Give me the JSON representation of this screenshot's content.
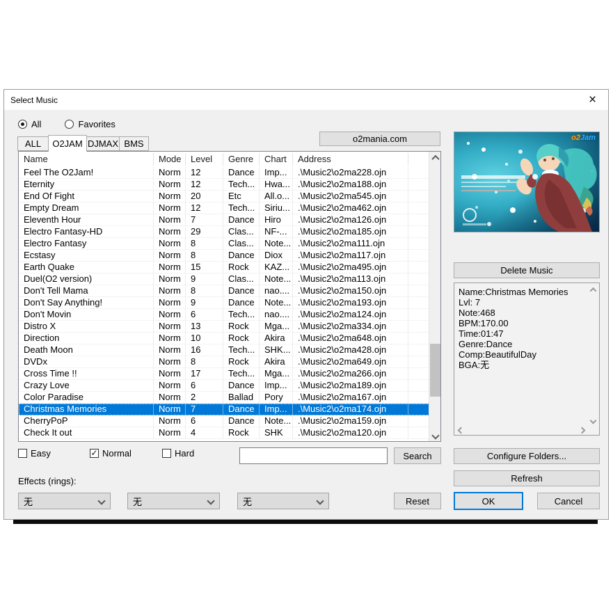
{
  "window": {
    "title": "Select Music",
    "close_icon": "×"
  },
  "filter": {
    "options": [
      {
        "label": "All",
        "selected": true
      },
      {
        "label": "Favorites",
        "selected": false
      }
    ]
  },
  "tabs": [
    {
      "label": "ALL",
      "active": false
    },
    {
      "label": "O2JAM",
      "active": true
    },
    {
      "label": "DJMAX",
      "active": false
    },
    {
      "label": "BMS",
      "active": false
    }
  ],
  "website_button": {
    "label": "o2mania.com"
  },
  "table": {
    "columns": [
      "Name",
      "Mode",
      "Level",
      "Genre",
      "Chart",
      "Address"
    ],
    "selected_index": 20,
    "rows": [
      {
        "name": "Feel The O2Jam!",
        "mode": "Norm",
        "level": "12",
        "genre": "Dance",
        "chart": "Imp...",
        "address": ".\\Music2\\o2ma228.ojn"
      },
      {
        "name": "Eternity",
        "mode": "Norm",
        "level": "12",
        "genre": "Tech...",
        "chart": "Hwa...",
        "address": ".\\Music2\\o2ma188.ojn"
      },
      {
        "name": "End Of Fight",
        "mode": "Norm",
        "level": "20",
        "genre": "Etc",
        "chart": "All.o...",
        "address": ".\\Music2\\o2ma545.ojn"
      },
      {
        "name": "Empty Dream",
        "mode": "Norm",
        "level": "12",
        "genre": "Tech...",
        "chart": "Siriu...",
        "address": ".\\Music2\\o2ma462.ojn"
      },
      {
        "name": "Eleventh Hour",
        "mode": "Norm",
        "level": "7",
        "genre": "Dance",
        "chart": "Hiro",
        "address": ".\\Music2\\o2ma126.ojn"
      },
      {
        "name": "Electro Fantasy-HD",
        "mode": "Norm",
        "level": "29",
        "genre": "Clas...",
        "chart": "NF-...",
        "address": ".\\Music2\\o2ma185.ojn"
      },
      {
        "name": "Electro Fantasy",
        "mode": "Norm",
        "level": "8",
        "genre": "Clas...",
        "chart": "Note...",
        "address": ".\\Music2\\o2ma111.ojn"
      },
      {
        "name": "Ecstasy",
        "mode": "Norm",
        "level": "8",
        "genre": "Dance",
        "chart": "Diox",
        "address": ".\\Music2\\o2ma117.ojn"
      },
      {
        "name": "Earth Quake",
        "mode": "Norm",
        "level": "15",
        "genre": "Rock",
        "chart": "KAZ...",
        "address": ".\\Music2\\o2ma495.ojn"
      },
      {
        "name": "Duel(O2 version)",
        "mode": "Norm",
        "level": "9",
        "genre": "Clas...",
        "chart": "Note...",
        "address": ".\\Music2\\o2ma113.ojn"
      },
      {
        "name": "Don't Tell Mama",
        "mode": "Norm",
        "level": "8",
        "genre": "Dance",
        "chart": "nao....",
        "address": ".\\Music2\\o2ma150.ojn"
      },
      {
        "name": "Don't Say Anything!",
        "mode": "Norm",
        "level": "9",
        "genre": "Dance",
        "chart": "Note...",
        "address": ".\\Music2\\o2ma193.ojn"
      },
      {
        "name": "Don't Movin",
        "mode": "Norm",
        "level": "6",
        "genre": "Tech...",
        "chart": "nao....",
        "address": ".\\Music2\\o2ma124.ojn"
      },
      {
        "name": "Distro X",
        "mode": "Norm",
        "level": "13",
        "genre": "Rock",
        "chart": "Mga...",
        "address": ".\\Music2\\o2ma334.ojn"
      },
      {
        "name": "Direction",
        "mode": "Norm",
        "level": "10",
        "genre": "Rock",
        "chart": "Akira",
        "address": ".\\Music2\\o2ma648.ojn"
      },
      {
        "name": "Death Moon",
        "mode": "Norm",
        "level": "16",
        "genre": "Tech...",
        "chart": "SHK...",
        "address": ".\\Music2\\o2ma428.ojn"
      },
      {
        "name": "DVDx",
        "mode": "Norm",
        "level": "8",
        "genre": "Rock",
        "chart": "Akira",
        "address": ".\\Music2\\o2ma649.ojn"
      },
      {
        "name": "Cross Time !!",
        "mode": "Norm",
        "level": "17",
        "genre": "Tech...",
        "chart": "Mga...",
        "address": ".\\Music2\\o2ma266.ojn"
      },
      {
        "name": "Crazy Love",
        "mode": "Norm",
        "level": "6",
        "genre": "Dance",
        "chart": "Imp...",
        "address": ".\\Music2\\o2ma189.ojn"
      },
      {
        "name": "Color Paradise",
        "mode": "Norm",
        "level": "2",
        "genre": "Ballad",
        "chart": "Pory",
        "address": ".\\Music2\\o2ma167.ojn"
      },
      {
        "name": "Christmas Memories",
        "mode": "Norm",
        "level": "7",
        "genre": "Dance",
        "chart": "Imp...",
        "address": ".\\Music2\\o2ma174.ojn"
      },
      {
        "name": "CherryPoP",
        "mode": "Norm",
        "level": "6",
        "genre": "Dance",
        "chart": "Note...",
        "address": ".\\Music2\\o2ma159.ojn"
      },
      {
        "name": "Check It out",
        "mode": "Norm",
        "level": "4",
        "genre": "Rock",
        "chart": "SHK",
        "address": ".\\Music2\\o2ma120.ojn"
      }
    ]
  },
  "preview": {
    "logo_o2": "o2",
    "logo_jam": "Jam"
  },
  "delete_button": {
    "label": "Delete Music"
  },
  "song_info": {
    "text": "Name:Christmas Memories\nLvl: 7\nNote:468\nBPM:170.00\nTime:01:47\nGenre:Dance\nComp:BeautifulDay\nBGA:无"
  },
  "difficulty": [
    {
      "label": "Easy",
      "checked": false
    },
    {
      "label": "Normal",
      "checked": true
    },
    {
      "label": "Hard",
      "checked": false
    }
  ],
  "search": {
    "value": "",
    "button_label": "Search"
  },
  "effects": {
    "label": "Effects (rings):",
    "dropdowns": [
      {
        "value": "无"
      },
      {
        "value": "无"
      },
      {
        "value": "无"
      }
    ]
  },
  "actions": {
    "configure": "Configure Folders...",
    "refresh": "Refresh",
    "reset": "Reset",
    "ok": "OK",
    "cancel": "Cancel"
  },
  "colors": {
    "selection": "#0078d7",
    "ok_focus_border": "#0078d7"
  }
}
